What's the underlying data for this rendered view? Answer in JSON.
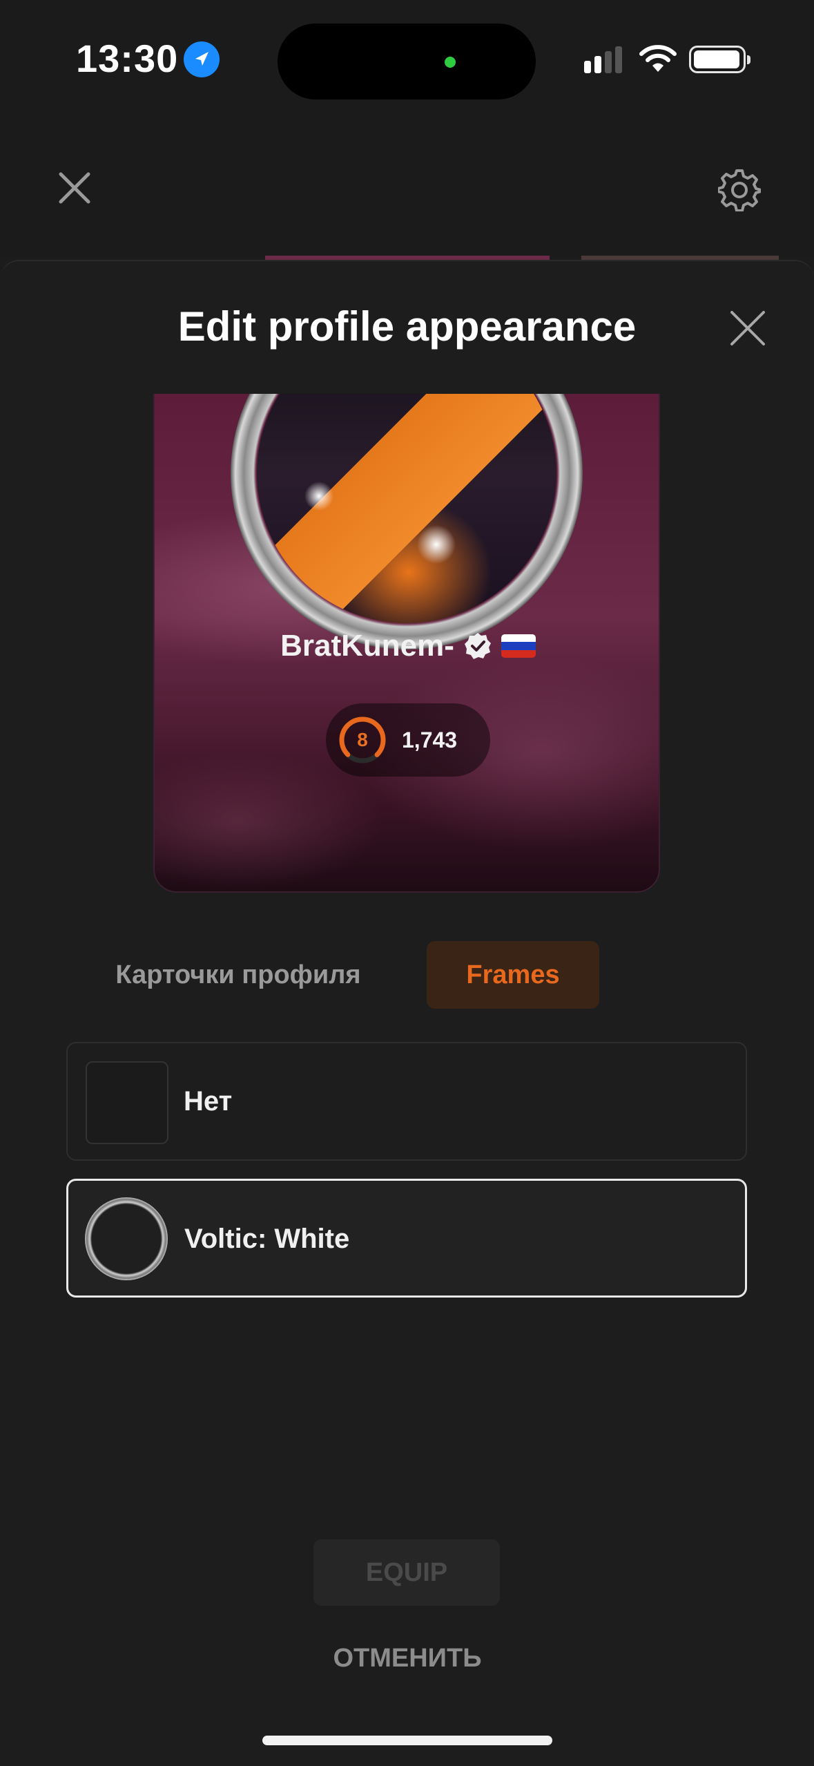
{
  "status_bar": {
    "time": "13:30"
  },
  "dialog": {
    "title": "Edit profile appearance"
  },
  "preview": {
    "username": "BratKunem-",
    "level": "8",
    "score": "1,743",
    "level_progress": 0.75,
    "flag_colors": [
      "#ffffff",
      "#1c3fbf",
      "#d52b1e"
    ]
  },
  "tabs": [
    {
      "label": "Карточки профиля",
      "active": false
    },
    {
      "label": "Frames",
      "active": true
    }
  ],
  "options": [
    {
      "label": "Нет",
      "selected": false
    },
    {
      "label": "Voltic: White",
      "selected": true
    }
  ],
  "actions": {
    "equip": "EQUIP",
    "cancel": "ОТМЕНИТЬ"
  },
  "colors": {
    "accent": "#e8691e",
    "background": "#1d1d1d"
  }
}
